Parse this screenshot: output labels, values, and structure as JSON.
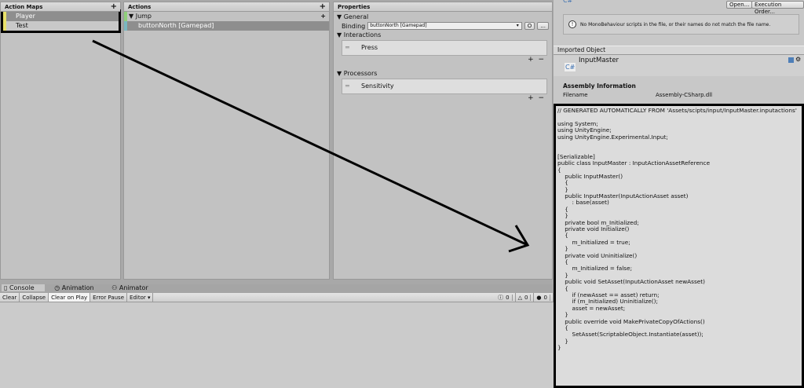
{
  "action_maps": {
    "title": "Action Maps",
    "items": [
      {
        "label": "Player",
        "color": "#e8e06a"
      },
      {
        "label": "Test",
        "color": "#e8e06a"
      }
    ]
  },
  "actions": {
    "title": "Actions",
    "items": [
      {
        "label": "Jump",
        "color": "#8fcf7a"
      },
      {
        "label": "buttonNorth [Gamepad]",
        "color": "#7ab8c0"
      }
    ]
  },
  "properties": {
    "title": "Properties",
    "general": "General",
    "binding_label": "Binding",
    "binding_value": "buttonNorth [Gamepad]",
    "btn_o": "O",
    "btn_more": "...",
    "interactions": "Interactions",
    "interaction_item": "Press",
    "processors": "Processors",
    "processor_item": "Sensitivity",
    "plus": "+",
    "minus": "−"
  },
  "inspector": {
    "open": "Open...",
    "exec": "Execution Order...",
    "warning": "No MonoBehaviour scripts in the file, or their names do not match the file name.",
    "imported": "Imported Object",
    "name": "InputMaster",
    "cs": "C#",
    "assembly": "Assembly Information",
    "filename_label": "Filename",
    "filename_value": "Assembly-CSharp.dll"
  },
  "code": [
    "// GENERATED AUTOMATICALLY FROM 'Assets/scipts/input/InputMaster.inputactions'",
    "",
    "using System;",
    "using UnityEngine;",
    "using UnityEngine.Experimental.Input;",
    "",
    "",
    "[Serializable]",
    "public class InputMaster : InputActionAssetReference",
    "{",
    "    public InputMaster()",
    "    {",
    "    }",
    "    public InputMaster(InputActionAsset asset)",
    "        : base(asset)",
    "    {",
    "    }",
    "    private bool m_Initialized;",
    "    private void Initialize()",
    "    {",
    "        m_Initialized = true;",
    "    }",
    "    private void Uninitialize()",
    "    {",
    "        m_Initialized = false;",
    "    }",
    "    public void SetAsset(InputActionAsset newAsset)",
    "    {",
    "        if (newAsset == asset) return;",
    "        if (m_Initialized) Uninitialize();",
    "        asset = newAsset;",
    "    }",
    "    public override void MakePrivateCopyOfActions()",
    "    {",
    "        SetAsset(ScriptableObject.Instantiate(asset));",
    "    }",
    "}"
  ],
  "console": {
    "tabs": [
      "Console",
      "Animation",
      "Animator"
    ],
    "buttons": [
      "Clear",
      "Collapse",
      "Clear on Play",
      "Error Pause",
      "Editor ▾"
    ],
    "counts": [
      "0",
      "0",
      "0"
    ]
  }
}
